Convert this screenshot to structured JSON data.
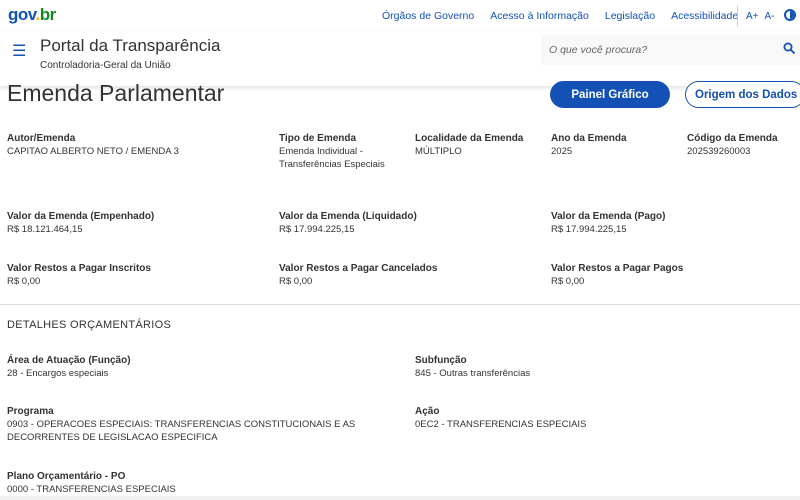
{
  "gov": {
    "logo_parts": [
      "gov",
      ".",
      "br"
    ],
    "links": [
      "Órgãos de Governo",
      "Acesso à Informação",
      "Legislação",
      "Acessibilidade"
    ],
    "font_increase": "A+",
    "font_decrease": "A-"
  },
  "header": {
    "title": "Portal da Transparência",
    "subtitle": "Controladoria-Geral da União",
    "search_placeholder": "O que você procura?"
  },
  "page": {
    "title": "Emenda Parlamentar",
    "btn_chart": "Painel Gráfico",
    "btn_origin": "Origem dos Dados"
  },
  "fields": {
    "autor": {
      "label": "Autor/Emenda",
      "value": "CAPITAO ALBERTO NETO / EMENDA 3"
    },
    "tipo": {
      "label": "Tipo de Emenda",
      "value1": "Emenda Individual -",
      "value2": "Transferências Especiais"
    },
    "localidade": {
      "label": "Localidade da Emenda",
      "value": "MÚLTIPLO"
    },
    "ano": {
      "label": "Ano da Emenda",
      "value": "2025"
    },
    "codigo": {
      "label": "Código da Emenda",
      "value": "202539260003"
    },
    "empenhado": {
      "label": "Valor da Emenda (Empenhado)",
      "value": "R$ 18.121.464,15"
    },
    "liquidado": {
      "label": "Valor da Emenda (Liquidado)",
      "value": "R$ 17.994.225,15"
    },
    "pago": {
      "label": "Valor da Emenda (Pago)",
      "value": "R$ 17.994.225,15"
    },
    "rp_inscritos": {
      "label": "Valor Restos a Pagar Inscritos",
      "value": "R$ 0,00"
    },
    "rp_cancelados": {
      "label": "Valor Restos a Pagar Cancelados",
      "value": "R$ 0,00"
    },
    "rp_pagos": {
      "label": "Valor Restos a Pagar Pagos",
      "value": "R$ 0,00"
    }
  },
  "detalhes": {
    "section_title": "DETALHES ORÇAMENTÁRIOS",
    "area": {
      "label": "Área de Atuação (Função)",
      "value": "28 - Encargos especiais"
    },
    "subfuncao": {
      "label": "Subfunção",
      "value": "845 - Outras transferências"
    },
    "programa": {
      "label": "Programa",
      "value1": "0903 - OPERACOES ESPECIAIS: TRANSFERENCIAS CONSTITUCIONAIS E AS",
      "value2": "DECORRENTES DE LEGISLACAO ESPECIFICA"
    },
    "acao": {
      "label": "Ação",
      "value": "0EC2 - TRANSFERENCIAS ESPECIAIS"
    },
    "po": {
      "label": "Plano Orçamentário - PO",
      "value": "0000 - TRANSFERENCIAS ESPECIAIS"
    }
  },
  "colors": {
    "primary": "#1351b4",
    "logo_yellow": "#f2b90c",
    "logo_green": "#168821"
  }
}
